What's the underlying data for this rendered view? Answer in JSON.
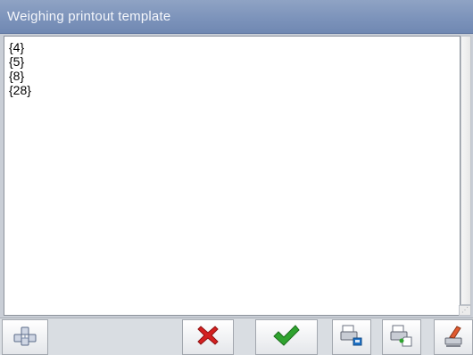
{
  "window": {
    "title": "Weighing printout template"
  },
  "editor": {
    "lines": [
      "{4}",
      "{5}",
      "{8}",
      "{28}"
    ]
  },
  "toolbar": {
    "buttons": [
      {
        "icon": "variables-icon"
      },
      {
        "icon": "cancel-icon",
        "color": "#d42020"
      },
      {
        "icon": "confirm-icon",
        "color": "#2fa32f"
      },
      {
        "icon": "export-template-icon"
      },
      {
        "icon": "import-template-icon"
      },
      {
        "icon": "clear-template-icon"
      }
    ]
  }
}
